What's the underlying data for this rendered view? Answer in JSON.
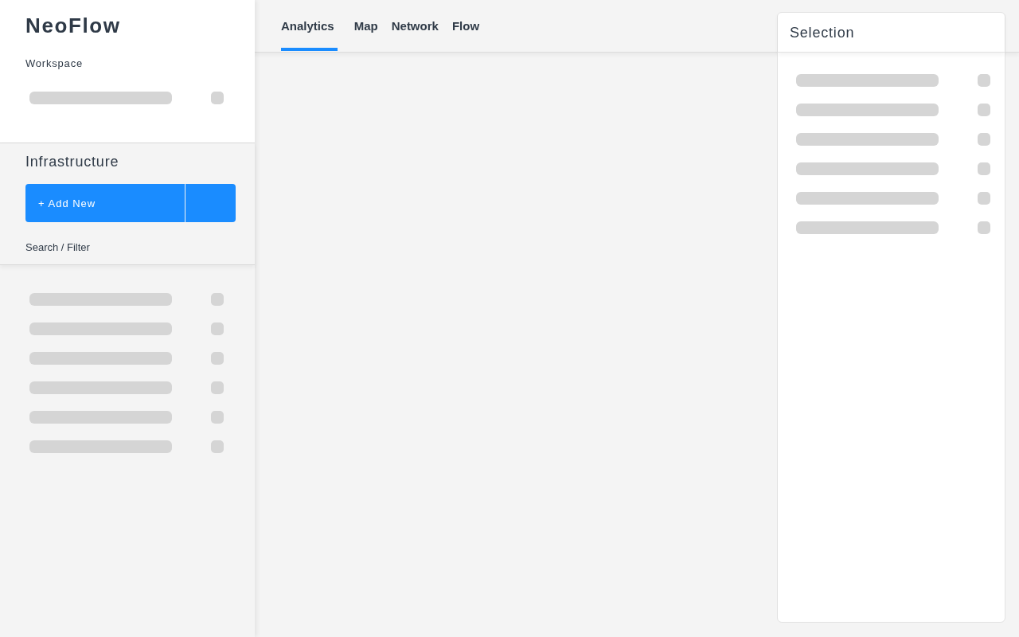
{
  "sidebar": {
    "brand": "NeoFlow",
    "workspace": {
      "label": "Workspace",
      "rows": [
        {
          "kind": "skeleton"
        }
      ]
    },
    "section": {
      "title": "Infrastructure",
      "add_button": "+ Add New",
      "filter_label": "Search / Filter"
    },
    "rows": [
      {
        "kind": "skeleton"
      },
      {
        "kind": "skeleton"
      },
      {
        "kind": "skeleton"
      },
      {
        "kind": "skeleton"
      },
      {
        "kind": "skeleton"
      },
      {
        "kind": "skeleton"
      }
    ]
  },
  "tabs": [
    {
      "label": "Analytics",
      "selected": true
    },
    {
      "label": "Map",
      "selected": false
    },
    {
      "label": "Network",
      "selected": false
    },
    {
      "label": "Flow",
      "selected": false
    }
  ],
  "selection_panel": {
    "title": "Selection",
    "rows": [
      {
        "kind": "skeleton"
      },
      {
        "kind": "skeleton"
      },
      {
        "kind": "skeleton"
      },
      {
        "kind": "skeleton"
      },
      {
        "kind": "skeleton"
      },
      {
        "kind": "skeleton"
      }
    ]
  }
}
